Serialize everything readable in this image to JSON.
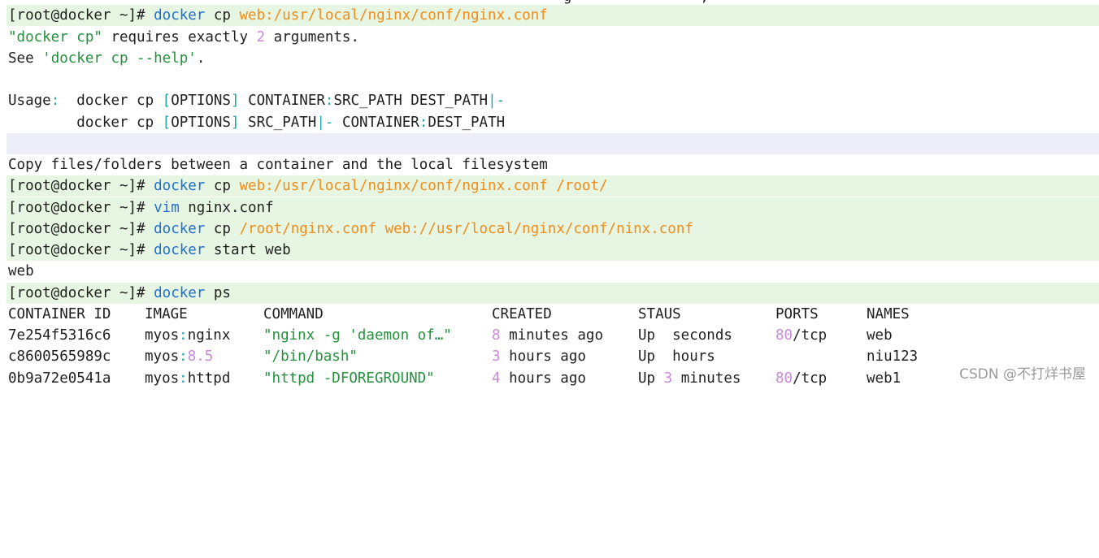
{
  "prompt": "[root@docker ~]# ",
  "cut_top": "                                                                 g               ,            ",
  "lines": {
    "l1": {
      "cmd": "docker",
      "arg1": " cp ",
      "arg2": "web:/usr/local/nginx/conf/nginx.conf"
    },
    "l2": {
      "a": "\"docker cp\"",
      "b": " requires exactly ",
      "c": "2",
      "d": " arguments."
    },
    "l3": {
      "a": "See ",
      "b": "'docker cp --help'",
      "c": "."
    },
    "l5": {
      "a": "Usage",
      "b": ":",
      "c": "  docker cp ",
      "d": "[",
      "e": "OPTIONS",
      "f": "]",
      "g": " CONTAINER",
      "h": ":",
      "i": "SRC_PATH DEST_PATH",
      "j": "|-"
    },
    "l6": {
      "a": "        docker cp ",
      "b": "[",
      "c": "OPTIONS",
      "d": "]",
      "e": " SRC_PATH",
      "f": "|-",
      "g": " CONTAINER",
      "h": ":",
      "i": "DEST_PATH"
    },
    "l8": {
      "a": "Copy files/folders between a container and the local filesystem"
    },
    "l9": {
      "cmd": "docker",
      "arg1": " cp ",
      "arg2": "web:/usr/local/nginx/conf/nginx.conf /root/"
    },
    "l10": {
      "cmd": "vim",
      "arg1": " nginx.conf"
    },
    "l11": {
      "cmd": "docker",
      "arg1": " cp ",
      "arg2": "/root/nginx.conf web://usr/local/nginx/conf/ninx.conf"
    },
    "l12": {
      "cmd": "docker",
      "arg1": " start web"
    },
    "l13": {
      "a": "web"
    },
    "l14": {
      "cmd": "docker",
      "arg1": " ps"
    }
  },
  "ps_table": {
    "headers": [
      "CONTAINER ID",
      "IMAGE",
      "COMMAND",
      "CREATED",
      "STAUS",
      "PORTS",
      "NAMES"
    ],
    "rows": [
      {
        "id": "7e254f5316c6",
        "image_a": "myos",
        "image_sep": ":",
        "image_b": "nginx",
        "command": "\"nginx -g 'daemon of…\"",
        "created_num": "8",
        "created_rest": " minutes ago",
        "status_a": "Up  seconds",
        "status_num": "",
        "status_rest": "",
        "ports_num": "80",
        "ports_rest": "/tcp",
        "name": "web"
      },
      {
        "id": "c8600565989c",
        "image_a": "myos",
        "image_sep": ":",
        "image_b": "8.5",
        "command": "\"/bin/bash\"",
        "created_num": "3",
        "created_rest": " hours ago",
        "status_a": "Up  hours",
        "status_num": "",
        "status_rest": "",
        "ports_num": "",
        "ports_rest": "",
        "name": "niu123"
      },
      {
        "id": "0b9a72e0541a",
        "image_a": "myos",
        "image_sep": ":",
        "image_b": "httpd",
        "command": "\"httpd -DFOREGROUND\"",
        "created_num": "4",
        "created_rest": " hours ago",
        "status_a": "Up ",
        "status_num": "3",
        "status_rest": " minutes",
        "ports_num": "80",
        "ports_rest": "/tcp",
        "name": "web1"
      }
    ]
  },
  "watermark": "CSDN @不打烊书屋",
  "colors": {
    "command": "#1f6fd1",
    "path": "#f08c1a",
    "string": "#23913c",
    "number": "#c98ad8",
    "punct": "#20a8a8",
    "highlight_green": "#e7f6e2",
    "highlight_blue": "#eeeef8"
  }
}
